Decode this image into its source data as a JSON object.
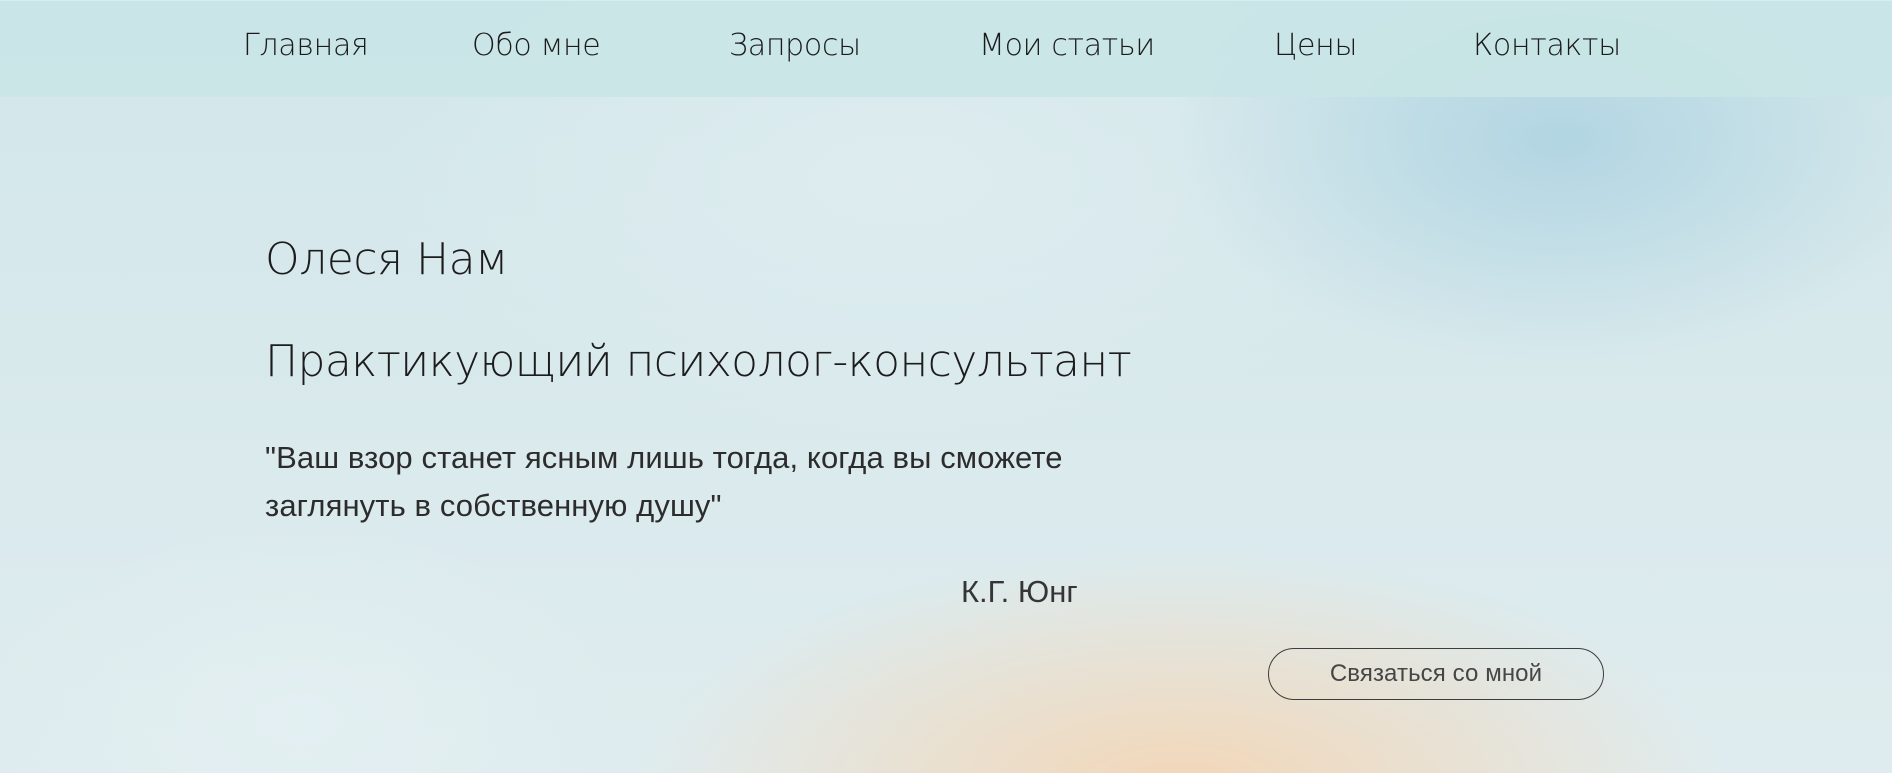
{
  "nav": {
    "items": [
      {
        "label": "Главная"
      },
      {
        "label": "Обо мне"
      },
      {
        "label": "Запросы"
      },
      {
        "label": "Мои статьи"
      },
      {
        "label": "Цены"
      },
      {
        "label": "Контакты"
      }
    ]
  },
  "hero": {
    "name": "Олеся Нам",
    "title": "Практикующий психолог-консультант",
    "quote": "\"Ваш взор станет ясным лишь тогда, когда вы сможете заглянуть в собственную душу\"",
    "author": "К.Г. Юнг",
    "button_label": "Связаться со мной"
  },
  "colors": {
    "nav_background": "#c9e5e6",
    "text": "#1c1c1c",
    "button_border": "#3d3d3d",
    "accent_blue": "#b0d4e2",
    "accent_peach": "#f3d6b6"
  }
}
